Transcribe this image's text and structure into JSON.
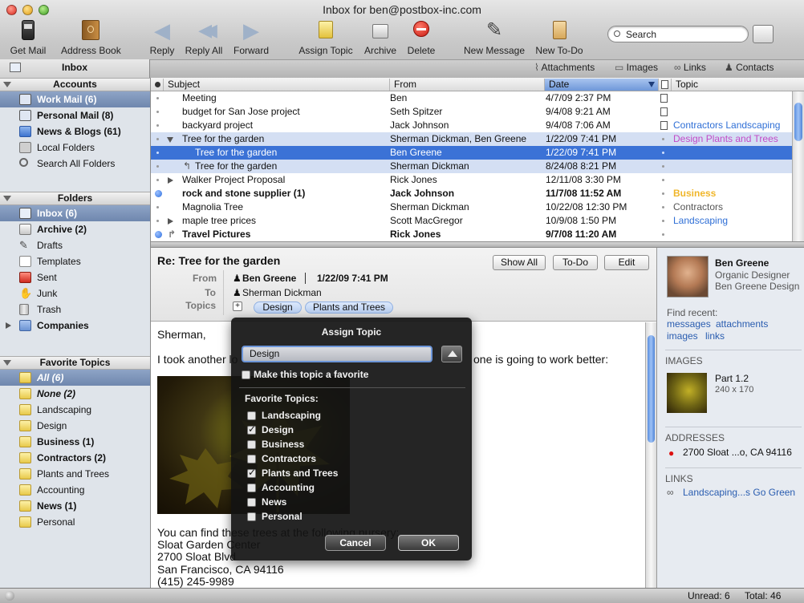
{
  "window": {
    "title": "Inbox for ben@postbox-inc.com"
  },
  "toolbar": {
    "get_mail": "Get Mail",
    "address_book": "Address Book",
    "reply": "Reply",
    "reply_all": "Reply All",
    "forward": "Forward",
    "assign_topic": "Assign Topic",
    "archive": "Archive",
    "delete": "Delete",
    "new_message": "New Message",
    "new_todo": "New To-Do",
    "search_placeholder": "Search"
  },
  "tabs": {
    "inbox": "Inbox",
    "attachments": "Attachments",
    "images": "Images",
    "links": "Links",
    "contacts": "Contacts"
  },
  "sidebar": {
    "accounts_header": "Accounts",
    "accounts": [
      {
        "label": "Work Mail (6)"
      },
      {
        "label": "Personal Mail (8)"
      },
      {
        "label": "News & Blogs (61)"
      },
      {
        "label": "Local Folders"
      },
      {
        "label": "Search All Folders"
      }
    ],
    "folders_header": "Folders",
    "folders": [
      {
        "label": "Inbox (6)"
      },
      {
        "label": "Archive (2)"
      },
      {
        "label": "Drafts"
      },
      {
        "label": "Templates"
      },
      {
        "label": "Sent"
      },
      {
        "label": "Junk"
      },
      {
        "label": "Trash"
      },
      {
        "label": "Companies"
      }
    ],
    "topics_header": "Favorite Topics",
    "topics": [
      {
        "label": "All (6)"
      },
      {
        "label": "None (2)"
      },
      {
        "label": "Landscaping"
      },
      {
        "label": "Design"
      },
      {
        "label": "Business (1)"
      },
      {
        "label": "Contractors (2)"
      },
      {
        "label": "Plants and Trees"
      },
      {
        "label": "Accounting"
      },
      {
        "label": "News (1)"
      },
      {
        "label": "Personal"
      }
    ]
  },
  "list": {
    "columns": {
      "subject": "Subject",
      "from": "From",
      "date": "Date",
      "topic": "Topic"
    },
    "rows": [
      {
        "subject": "Meeting",
        "from": "Ben",
        "date": "4/7/09 2:37 PM",
        "topic": ""
      },
      {
        "subject": "budget for San Jose project",
        "from": "Seth Spitzer",
        "date": "9/4/08 9:21 AM",
        "topic": ""
      },
      {
        "subject": "backyard project",
        "from": "Jack Johnson",
        "date": "9/4/08 7:06 AM",
        "topic": "Contractors Landscaping"
      },
      {
        "subject": "Tree for the garden",
        "from": "Sherman Dickman, Ben Greene",
        "date": "1/22/09 7:41 PM",
        "topic": "Design Plants and Trees"
      },
      {
        "subject": "Tree for the garden",
        "from": "Ben Greene",
        "date": "1/22/09 7:41 PM",
        "topic": ""
      },
      {
        "subject": "Tree for the garden",
        "from": "Sherman Dickman",
        "date": "8/24/08 8:21 PM",
        "topic": ""
      },
      {
        "subject": "Walker Project Proposal",
        "from": "Rick Jones",
        "date": "12/11/08 3:30 PM",
        "topic": ""
      },
      {
        "subject": "rock and stone supplier (1)",
        "from": "Jack Johnson",
        "date": "11/7/08 11:52 AM",
        "topic": "Business"
      },
      {
        "subject": "Magnolia Tree",
        "from": "Sherman Dickman",
        "date": "10/22/08 12:30 PM",
        "topic": "Contractors"
      },
      {
        "subject": "maple tree prices",
        "from": "Scott MacGregor",
        "date": "10/9/08 1:50 PM",
        "topic": "Landscaping"
      },
      {
        "subject": "Travel Pictures",
        "from": "Rick Jones",
        "date": "9/7/08 11:20 AM",
        "topic": ""
      }
    ]
  },
  "message": {
    "subject": "Re: Tree for the garden",
    "show_all": "Show All",
    "todo": "To-Do",
    "edit": "Edit",
    "from_label": "From",
    "to_label": "To",
    "topics_label": "Topics",
    "from": "Ben Greene",
    "date": "1/22/09 7:41 PM",
    "to": "Sherman Dickman",
    "topic_pills": [
      "Design",
      "Plants and Trees"
    ],
    "greeting": "Sherman,",
    "line1_a": "I took another lo",
    "line1_b": "one is going to work better:",
    "line2": "You can find these trees at the following nursery:",
    "addr1": "Sloat Garden Center",
    "addr2": "2700 Sloat Blvd",
    "addr3": "San Francisco, CA  94116",
    "addr4": "(415) 245-9989"
  },
  "contact": {
    "name": "Ben Greene",
    "role": "Organic Designer",
    "company": "Ben Greene Design",
    "find_recent": "Find recent:",
    "messages": "messages",
    "attachments": "attachments",
    "images": "images",
    "links": "links",
    "images_header": "IMAGES",
    "image_name": "Part 1.2",
    "image_size": "240 x 170",
    "addresses_header": "ADDRESSES",
    "address": "2700 Sloat ...o, CA 94116",
    "links_header": "LINKS",
    "link": "Landscaping...s Go Green"
  },
  "status": {
    "unread": "Unread: 6",
    "total": "Total: 46"
  },
  "dialog": {
    "title": "Assign Topic",
    "input_value": "Design",
    "favorite_label": "Make this topic a favorite",
    "favorites_header": "Favorite Topics:",
    "topics": [
      {
        "label": "Landscaping",
        "checked": false
      },
      {
        "label": "Design",
        "checked": true
      },
      {
        "label": "Business",
        "checked": false
      },
      {
        "label": "Contractors",
        "checked": false
      },
      {
        "label": "Plants and Trees",
        "checked": true
      },
      {
        "label": "Accounting",
        "checked": false
      },
      {
        "label": "News",
        "checked": false
      },
      {
        "label": "Personal",
        "checked": false
      }
    ],
    "cancel": "Cancel",
    "ok": "OK"
  },
  "colors": {
    "selection": "#3b72d6",
    "thread": "#d4dff3",
    "topic_design": "#c34ac7",
    "topic_business": "#f0b62a",
    "topic_landscaping": "#2f6fd6",
    "link": "#2a5db0"
  }
}
